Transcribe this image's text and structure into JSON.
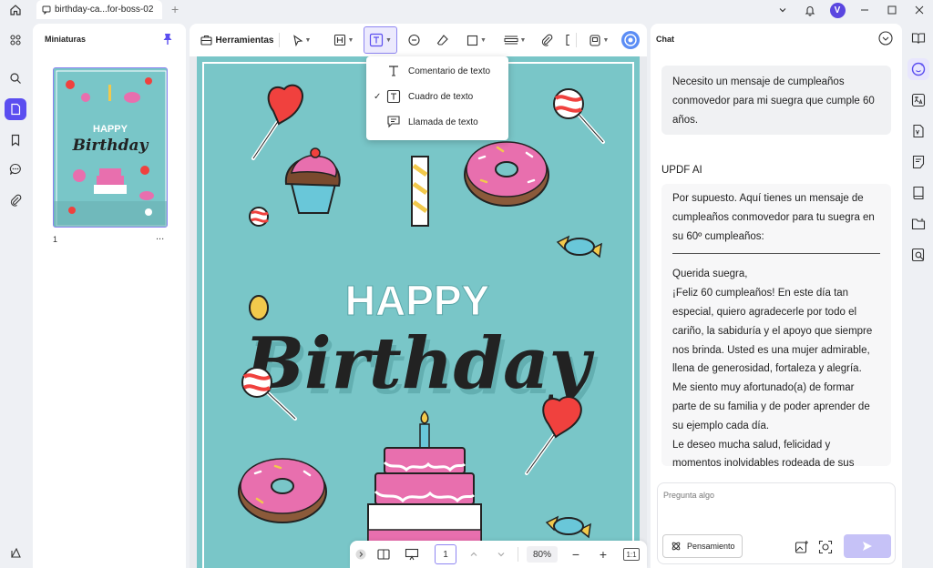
{
  "titlebar": {
    "tab_title": "birthday-ca...for-boss-02",
    "add_tab": "+",
    "avatar_letter": "V"
  },
  "thumbnails": {
    "title": "Miniaturas",
    "page_number": "1",
    "more": "..."
  },
  "toolbar": {
    "tools_label": "Herramientas"
  },
  "text_menu": {
    "items": [
      {
        "label": "Comentario de texto",
        "checked": false
      },
      {
        "label": "Cuadro de texto",
        "checked": true
      },
      {
        "label": "Llamada de texto",
        "checked": false
      }
    ],
    "check_mark": "✓"
  },
  "document": {
    "happy": "HAPPY",
    "birthday": "Birthday"
  },
  "bottombar": {
    "current_page": "1",
    "zoom": "80%",
    "minus": "−",
    "plus": "+",
    "fit": "1:1"
  },
  "chat": {
    "title": "Chat",
    "user_message": "Necesito un mensaje de cumpleaños conmovedor para mi suegra que cumple 60 años.",
    "ai_label": "UPDF AI",
    "ai_intro": "Por supuesto. Aquí tienes un mensaje de cumpleaños conmovedor para tu suegra en su 60º cumpleaños:",
    "ai_body": [
      "Querida suegra,",
      "¡Feliz 60 cumpleaños! En este día tan especial, quiero agradecerle por todo el cariño, la sabiduría y el apoyo que siempre nos brinda. Usted es una mujer admirable, llena de generosidad, fortaleza y alegría.",
      "Me siento muy afortunado(a) de formar parte de su familia y de poder aprender de su ejemplo cada día.",
      "Le deseo mucha salud, felicidad y momentos inolvidables rodeada de sus"
    ],
    "input_placeholder": "Pregunta algo",
    "thinking_label": "Pensamiento"
  },
  "colors": {
    "accent": "#5b4ef0",
    "page_bg": "#79c6c8",
    "pink": "#e86fae",
    "red": "#f0413e"
  }
}
